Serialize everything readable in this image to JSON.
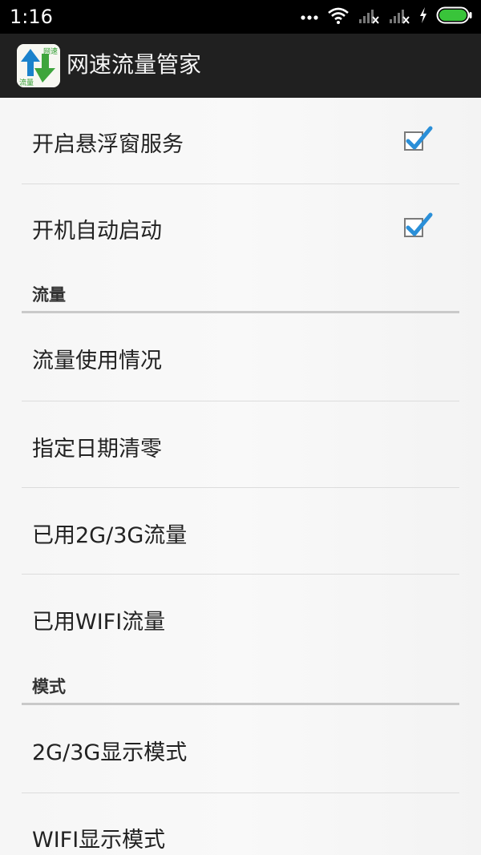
{
  "status_bar": {
    "time": "1:16"
  },
  "app_bar": {
    "title": "网速流量管家",
    "icon_text_top": "网速",
    "icon_text_bottom": "流量"
  },
  "settings": {
    "float_window": {
      "label": "开启悬浮窗服务",
      "checked": true
    },
    "auto_start": {
      "label": "开机自动启动",
      "checked": true
    }
  },
  "traffic_section": {
    "title": "流量",
    "items": [
      "流量使用情况",
      "指定日期清零",
      "已用2G/3G流量",
      "已用WIFI流量"
    ]
  },
  "mode_section": {
    "title": "模式",
    "items": [
      "2G/3G显示模式",
      "WIFI显示模式"
    ]
  },
  "colors": {
    "check_blue": "#2a8fd8",
    "app_bar": "#202020",
    "battery_green": "#39c43a"
  }
}
